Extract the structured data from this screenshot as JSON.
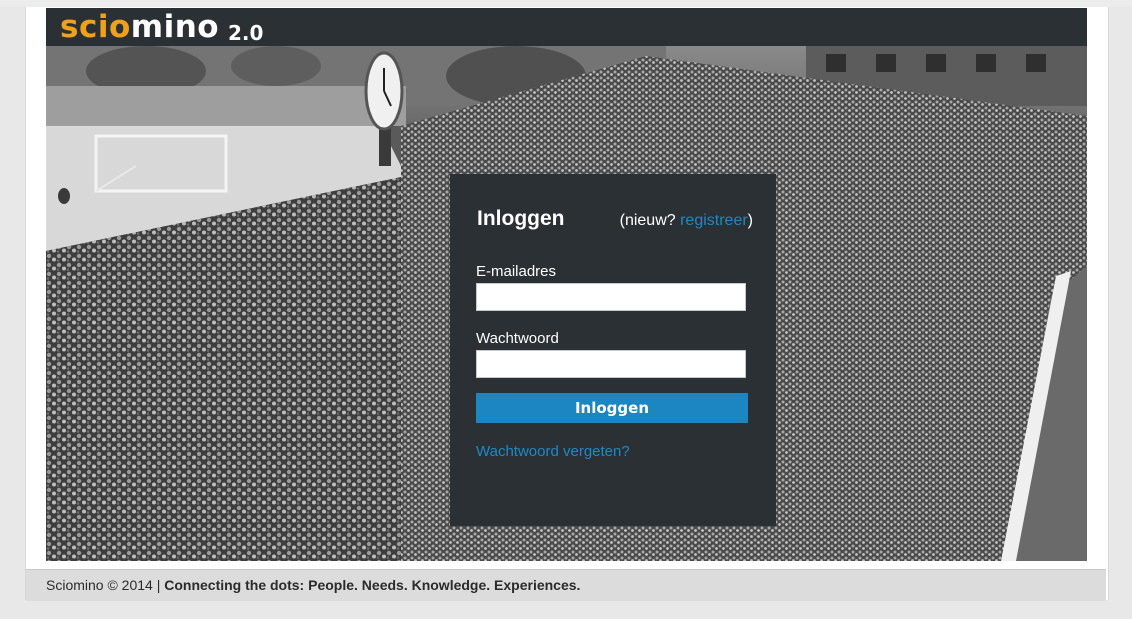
{
  "brand": {
    "logo_part1": "scio",
    "logo_part2": "mino",
    "version": "2.0"
  },
  "login": {
    "title": "Inloggen",
    "register_prefix": "(nieuw? ",
    "register_link": "registreer",
    "register_suffix": ")",
    "email_label": "E-mailadres",
    "email_value": "",
    "password_label": "Wachtwoord",
    "password_value": "",
    "submit_label": "Inloggen",
    "forgot_link": "Wachtwoord vergeten?"
  },
  "footer": {
    "copyright": "Sciomino © 2014 | ",
    "tagline": "Connecting the dots: People. Needs. Knowledge. Experiences."
  },
  "colors": {
    "header_bg": "#2b3034",
    "logo_accent": "#f0a11a",
    "link": "#1b8ac7",
    "button": "#1b86c2"
  }
}
